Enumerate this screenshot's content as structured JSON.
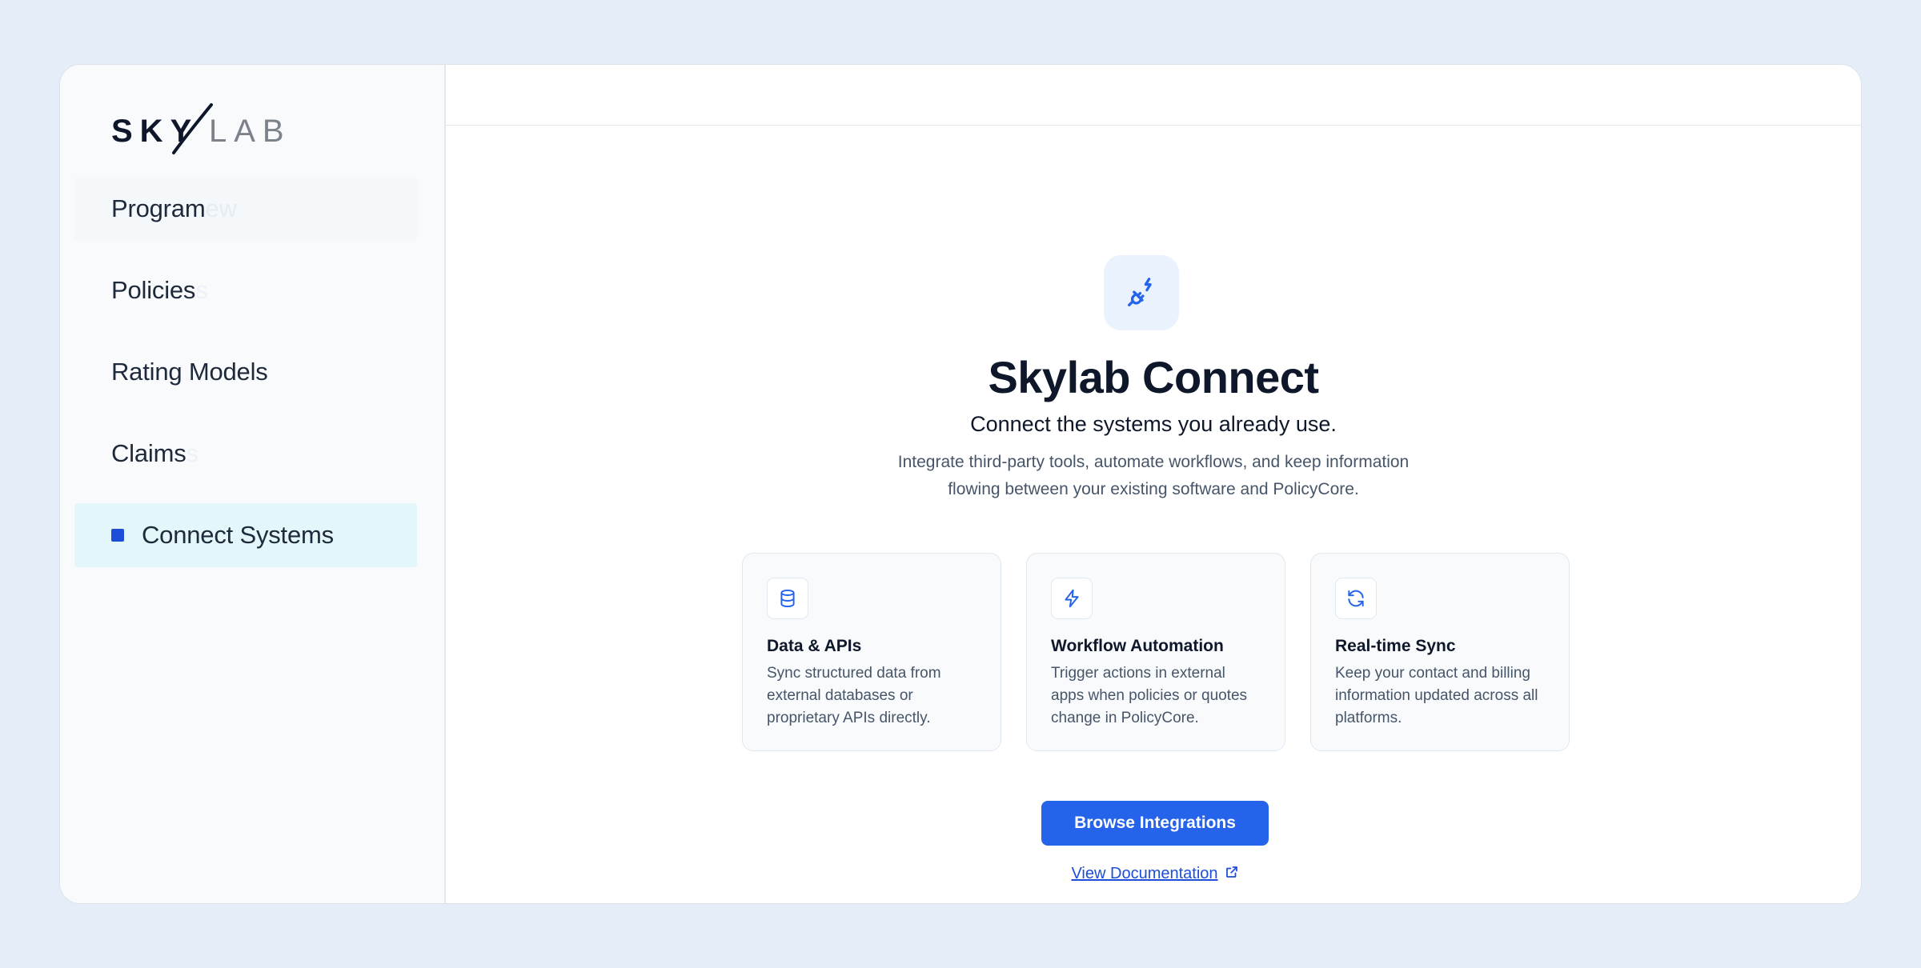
{
  "brand": {
    "logo_part1": "SKY",
    "logo_part2": "LAB"
  },
  "sidebar": {
    "items": [
      {
        "label": "Program",
        "ghost": "ew",
        "state": "first"
      },
      {
        "label": "Policies",
        "ghost": "s",
        "state": "normal"
      },
      {
        "label": "Rating Models",
        "ghost": "",
        "state": "normal"
      },
      {
        "label": "Claims",
        "ghost": "s",
        "state": "normal"
      },
      {
        "label": "Connect Systems",
        "ghost": "",
        "state": "active"
      }
    ]
  },
  "hero": {
    "icon": "plug-icon",
    "title": "Skylab Connect",
    "subtitle": "Connect the systems you already use.",
    "description_line1": "Integrate third-party tools, automate workflows, and keep information",
    "description_line2": "flowing between your existing software and PolicyCore."
  },
  "features": [
    {
      "icon": "database-icon",
      "title": "Data & APIs",
      "line1": "Sync structured data from",
      "line2": "external databases or",
      "line3": "proprietary APIs directly."
    },
    {
      "icon": "lightning-icon",
      "title": "Workflow Automation",
      "line1": "Trigger actions in external",
      "line2": "apps when policies or quotes",
      "line3": "change in PolicyCore."
    },
    {
      "icon": "refresh-icon",
      "title": "Real-time Sync",
      "line1": "Keep your contact and billing",
      "line2": "information updated across all",
      "line3": "platforms."
    }
  ],
  "actions": {
    "primary_label": "Browse Integrations",
    "doc_link_label": "View Documentation"
  },
  "colors": {
    "accent": "#2563eb",
    "active_nav_bg": "#e3f6fa",
    "page_bg": "#e5eef8"
  }
}
